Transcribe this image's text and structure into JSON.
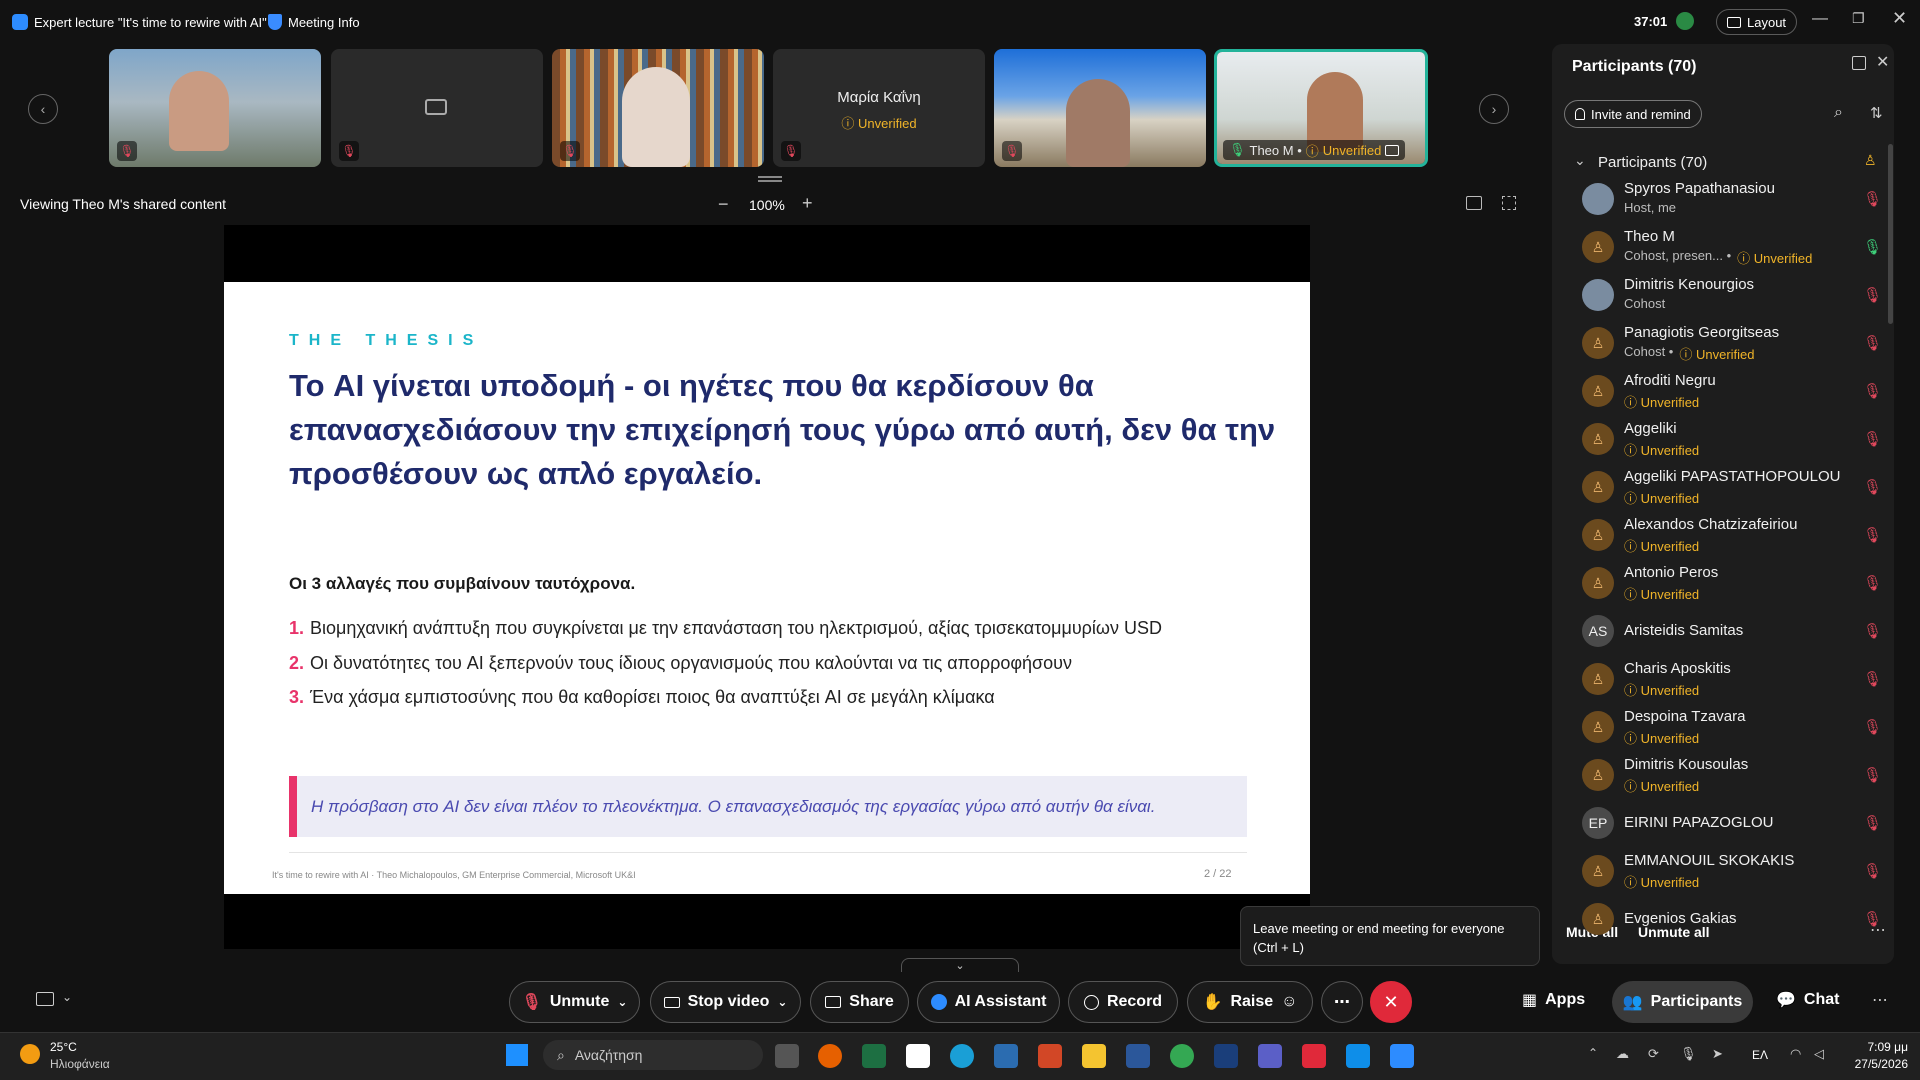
{
  "topbar": {
    "title": "Expert lecture \"It's time to rewire with AI\"",
    "meeting_info": "Meeting Info",
    "timer": "37:01",
    "layout": "Layout"
  },
  "thumbnails": [
    {
      "kind": "video",
      "name": ""
    },
    {
      "kind": "video-off",
      "name": ""
    },
    {
      "kind": "video",
      "name": ""
    },
    {
      "kind": "name",
      "name": "Μαρία Καΐνη",
      "status": "Unverified"
    },
    {
      "kind": "video",
      "name": ""
    },
    {
      "kind": "video",
      "name": "Theo M •",
      "status": "Unverified"
    }
  ],
  "share": {
    "viewing": "Viewing Theo M's shared content",
    "zoom": "100%"
  },
  "slide": {
    "kicker": "THE THESIS",
    "headline": "Το AI γίνεται υποδομή - οι ηγέτες που θα κερδίσουν θα επανασχεδιάσουν την επιχείρησή τους γύρω από αυτή, δεν θα την προσθέσουν ως απλό εργαλείο.",
    "subhead": "Οι 3 αλλαγές που συμβαίνουν ταυτόχρονα.",
    "items": [
      {
        "n": "1.",
        "text": "Βιομηχανική ανάπτυξη που συγκρίνεται με την επανάσταση του ηλεκτρισμού, αξίας τρισεκατομμυρίων USD"
      },
      {
        "n": "2.",
        "text": "Οι δυνατότητες του AI ξεπερνούν τους ίδιους οργανισμούς που καλούνται να τις απορροφήσουν"
      },
      {
        "n": "3.",
        "text": "Ένα χάσμα εμπιστοσύνης που θα καθορίσει ποιος θα αναπτύξει AI σε μεγάλη κλίμακα"
      }
    ],
    "quote": "Η πρόσβαση στο AI δεν είναι πλέον το πλεονέκτημα. Ο επανασχεδιασμός της εργασίας γύρω από αυτήν θα είναι.",
    "footer_left": "It's time to rewire with AI  ·  Theo Michalopoulos, GM Enterprise Commercial, Microsoft UK&I",
    "page": "2 / 22"
  },
  "panel": {
    "title": "Participants (70)",
    "invite": "Invite and remind",
    "section": "Participants (70)",
    "mute_all": "Mute all",
    "unmute_all": "Unmute all",
    "people": [
      {
        "name": "Spyros Papathanasiou",
        "sub": "Host, me",
        "unv": "",
        "initials": "",
        "mic": "off"
      },
      {
        "name": "Theo M",
        "sub": "Cohost, presen... •",
        "unv": "Unverified",
        "initials": "",
        "mic": "on"
      },
      {
        "name": "Dimitris Kenourgios",
        "sub": "Cohost",
        "unv": "",
        "initials": "",
        "mic": "off"
      },
      {
        "name": "Panagiotis Georgitseas",
        "sub": "Cohost •",
        "unv": "Unverified",
        "initials": "",
        "mic": "off"
      },
      {
        "name": "Afroditi Negru",
        "sub": "",
        "unv": "Unverified",
        "initials": "",
        "mic": "off"
      },
      {
        "name": "Aggeliki",
        "sub": "",
        "unv": "Unverified",
        "initials": "",
        "mic": "off"
      },
      {
        "name": "Aggeliki PAPASTATHOPOULOU",
        "sub": "",
        "unv": "Unverified",
        "initials": "",
        "mic": "off"
      },
      {
        "name": "Alexandos Chatzizafeiriou",
        "sub": "",
        "unv": "Unverified",
        "initials": "",
        "mic": "off"
      },
      {
        "name": "Antonio Peros",
        "sub": "",
        "unv": "Unverified",
        "initials": "",
        "mic": "off"
      },
      {
        "name": "Aristeidis Samitas",
        "sub": "",
        "unv": "",
        "initials": "AS",
        "mic": "off"
      },
      {
        "name": "Charis Aposkitis",
        "sub": "",
        "unv": "Unverified",
        "initials": "",
        "mic": "off"
      },
      {
        "name": "Despoina Tzavara",
        "sub": "",
        "unv": "Unverified",
        "initials": "",
        "mic": "off"
      },
      {
        "name": "Dimitris Kousoulas",
        "sub": "",
        "unv": "Unverified",
        "initials": "",
        "mic": "off"
      },
      {
        "name": "EIRINI PAPAZOGLOU",
        "sub": "",
        "unv": "",
        "initials": "EP",
        "mic": "off"
      },
      {
        "name": "EMMANOUIL SKOKAKIS",
        "sub": "",
        "unv": "Unverified",
        "initials": "",
        "mic": "off"
      },
      {
        "name": "Evgenios Gakias",
        "sub": "",
        "unv": "",
        "initials": "",
        "mic": "off"
      }
    ]
  },
  "tooltip": "Leave meeting or end meeting for everyone (Ctrl + L)",
  "controls": {
    "unmute": "Unmute",
    "stop_video": "Stop video",
    "share": "Share",
    "ai": "AI Assistant",
    "record": "Record",
    "raise": "Raise",
    "apps": "Apps",
    "participants": "Participants",
    "chat": "Chat"
  },
  "taskbar": {
    "temp": "25°C",
    "weather": "Ηλιοφάνεια",
    "search": "Αναζήτηση",
    "lang": "ΕΛ",
    "time": "7:09 μμ",
    "date": "27/5/2026"
  },
  "colors": {
    "accent": "#1bb5c9",
    "headline": "#1f2a6b",
    "pink": "#e8336a",
    "unverified": "#f0b429",
    "end": "#e0293a"
  }
}
